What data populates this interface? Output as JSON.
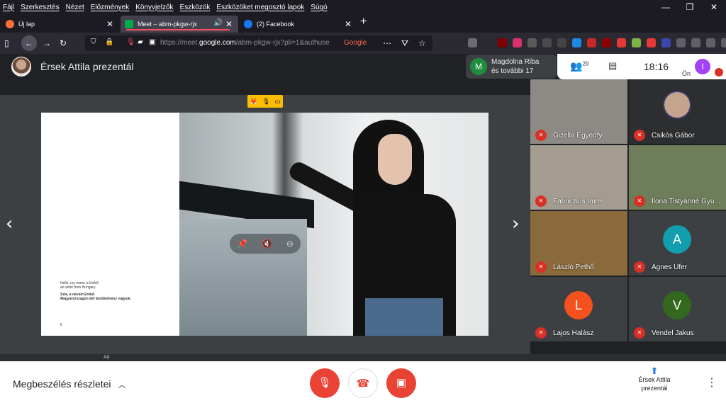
{
  "menubar": {
    "items": [
      "Fájl",
      "Szerkesztés",
      "Nézet",
      "Előzmények",
      "Könyvjelzők",
      "Eszközök",
      "Eszközöket megosztó lapok",
      "Súgó"
    ]
  },
  "window_controls": {
    "minimize": "—",
    "restore": "❐",
    "close": "✕"
  },
  "tabs": [
    {
      "title": "Új lap",
      "favicon_color": "#ff7139",
      "active": false
    },
    {
      "title": "Meet – abm-pkgw-rjx",
      "favicon_color": "#00ac47",
      "active": true,
      "audio": "🔊"
    },
    {
      "title": "(2) Facebook",
      "favicon_color": "#1877f2",
      "active": false
    }
  ],
  "new_tab": "+",
  "navbar": {
    "url_prefix": "https://meet.",
    "url_domain": "google.com",
    "url_rest": "/abm-pkgw-rjx?pli=1&authuse",
    "google_badge": "Google"
  },
  "meeting": {
    "presenter_title": "Érsek Attila prezentál",
    "notification_initial": "M",
    "notification_line1": "Magdolna Riba",
    "notification_line2": "és további 17",
    "people_count": "29",
    "time": "18:16",
    "self_label": "Ön",
    "self_initial": "I",
    "self_color": "#a142f4"
  },
  "slide": {
    "text_line1": "Hello, my name is Enikő,",
    "text_line2": "an artist from Hungary.",
    "text_hu1": "Szia, a nevem Enikő.",
    "text_hu2": "Magyarországon élő festőművész vagyok.",
    "page_number": "6"
  },
  "participants": [
    {
      "name": "Gizella Egyedfy",
      "type": "video",
      "color": "#8d8a86"
    },
    {
      "name": "Csikós Gábor",
      "type": "photo",
      "color": "#2c2e30"
    },
    {
      "name": "Fabriczius Imre",
      "type": "video",
      "color": "#a49c90"
    },
    {
      "name": "Ilona Tistyánné Gyu...",
      "type": "video",
      "color": "#6e7d5a"
    },
    {
      "name": "László Pethő",
      "type": "video",
      "color": "#8a6a3a"
    },
    {
      "name": "Agnes Ufer",
      "type": "letter",
      "initial": "A",
      "color": "#129eaf"
    },
    {
      "name": "Lajos Halász",
      "type": "letter",
      "initial": "L",
      "color": "#f4511e"
    },
    {
      "name": "Vendel Jakus",
      "type": "letter",
      "initial": "V",
      "color": "#33691e"
    }
  ],
  "ad_label": "Ad",
  "bottombar": {
    "details_label": "Megbeszélés részletei",
    "presenting_line1": "Érsek Attila",
    "presenting_line2": "prezentál",
    "accent_red": "#ea4335"
  }
}
